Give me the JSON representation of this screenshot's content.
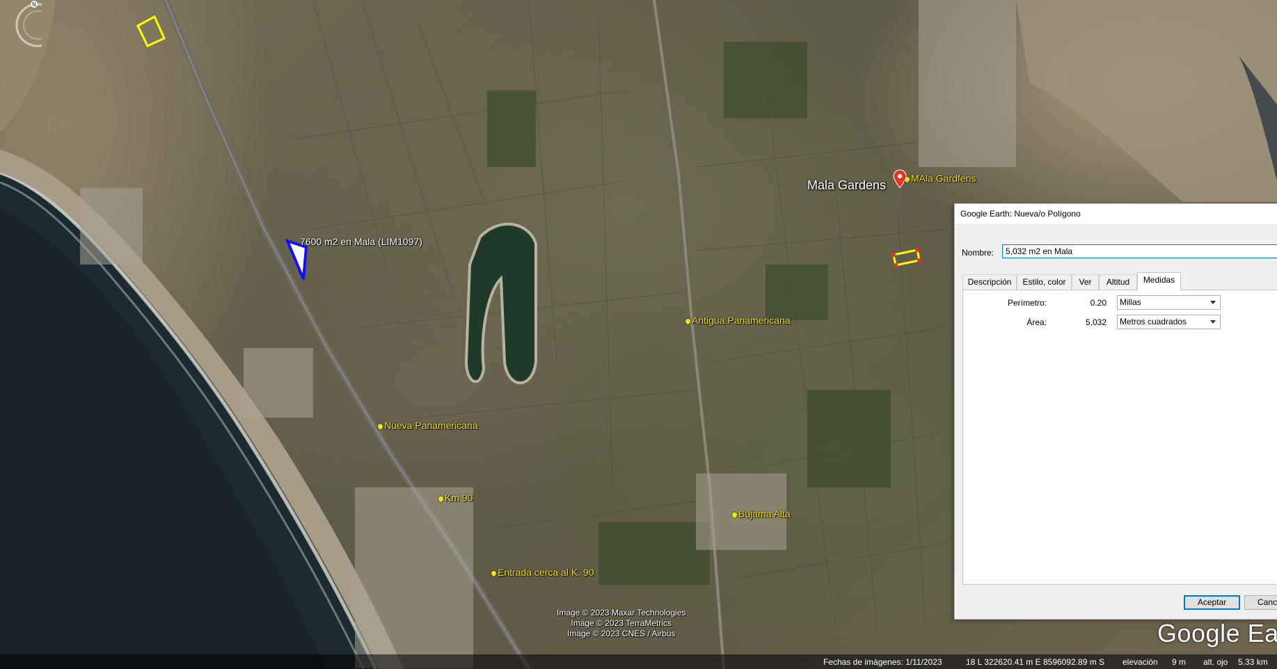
{
  "map": {
    "labels": {
      "mala_gardens_big": "Mala Gardens",
      "mala_gardens_pin": "MAla Gardfens",
      "polygon_7600": "7600 m2 en Mala (LIM1097)",
      "antigua_panamericana": "Antigua Panamericana",
      "nueva_panamericana": "Nueva Panamericana",
      "km90": "Km 90",
      "bujama_alta": "Bujama Alta",
      "entrada": "Entrada cerca al K. 90"
    },
    "copyright": [
      "Image © 2023 Maxar Technologies",
      "Image © 2023 TerraMetrics",
      "Image © 2023 CNES / Airbus"
    ],
    "logo": "Google Earth",
    "colors": {
      "label_yellow": "#f6e21b",
      "polygon_yellow": "#ffff00",
      "polygon_blue": "#1010ff",
      "pin_red": "#e8342a"
    }
  },
  "statusbar": {
    "imagery_date": "Fechas de imágenes: 1/11/2023",
    "coords": "18 L 322620.41 m E 8596092.89 m S",
    "elevation_label": "elevación",
    "elevation_value": "9 m",
    "eye_alt_label": "alt. ojo",
    "eye_alt_value": "5.33 km"
  },
  "dialog": {
    "title": "Google Earth: Nueva/o Polígono",
    "name_label": "Nombre:",
    "name_value": "5,032 m2 en Mala",
    "tabs": [
      "Descripción",
      "Estilo, color",
      "Ver",
      "Altitud",
      "Medidas"
    ],
    "active_tab": "Medidas",
    "measures": {
      "perimeter_label": "Perímetro:",
      "perimeter_value": "0.20",
      "perimeter_unit": "Millas",
      "area_label": "Área:",
      "area_value": "5,032",
      "area_unit": "Metros cuadrados"
    },
    "ok_label": "Aceptar",
    "cancel_label": "Cance"
  }
}
